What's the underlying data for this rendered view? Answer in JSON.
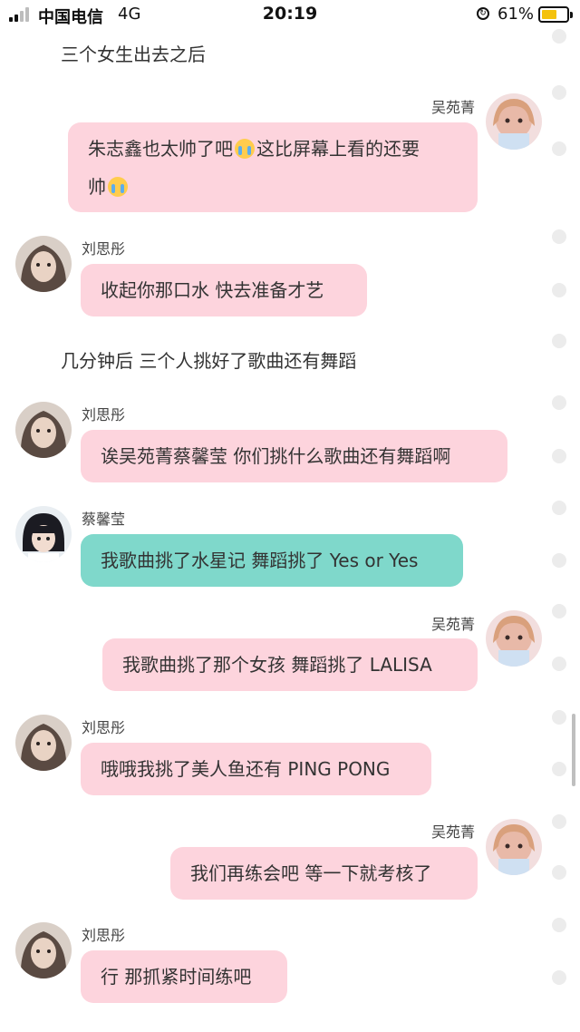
{
  "status_bar": {
    "carrier": "中国电信",
    "network": "4G",
    "time": "20:19",
    "battery_percent": "61%",
    "battery_level": 0.61
  },
  "messages": [
    {
      "kind": "narration",
      "text": "三个女生出去之后"
    },
    {
      "kind": "message",
      "side": "right",
      "sender": "吴苑菁",
      "line1": "朱志鑫也太帅了吧",
      "line1b": "这比屏幕上看的还要",
      "line2": "帅",
      "color": "pink"
    },
    {
      "kind": "message",
      "side": "left",
      "sender": "刘思彤",
      "text": "收起你那口水 快去准备才艺",
      "color": "pink"
    },
    {
      "kind": "narration",
      "text": "几分钟后 三个人挑好了歌曲还有舞蹈"
    },
    {
      "kind": "message",
      "side": "left",
      "sender": "刘思彤",
      "text": "诶吴苑菁蔡馨莹 你们挑什么歌曲还有舞蹈啊",
      "color": "pink"
    },
    {
      "kind": "message",
      "side": "left",
      "sender": "蔡馨莹",
      "text": "我歌曲挑了水星记 舞蹈挑了 Yes or Yes",
      "color": "teal"
    },
    {
      "kind": "message",
      "side": "right",
      "sender": "吴苑菁",
      "text": "我歌曲挑了那个女孩 舞蹈挑了 LALISA",
      "color": "pink"
    },
    {
      "kind": "message",
      "side": "left",
      "sender": "刘思彤",
      "text": "哦哦我挑了美人鱼还有 PING PONG",
      "color": "pink"
    },
    {
      "kind": "message",
      "side": "right",
      "sender": "吴苑菁",
      "text": "我们再练会吧 等一下就考核了",
      "color": "pink"
    },
    {
      "kind": "message",
      "side": "left",
      "sender": "刘思彤",
      "text": "行 那抓紧时间练吧",
      "color": "pink"
    }
  ],
  "colors": {
    "bubble_pink": "#fdd4dd",
    "bubble_teal": "#7fd8cb",
    "battery": "#f4c20d"
  },
  "icons": [
    "signal-icon",
    "lock-rotation-icon",
    "battery-icon",
    "crying-emoji-icon"
  ]
}
